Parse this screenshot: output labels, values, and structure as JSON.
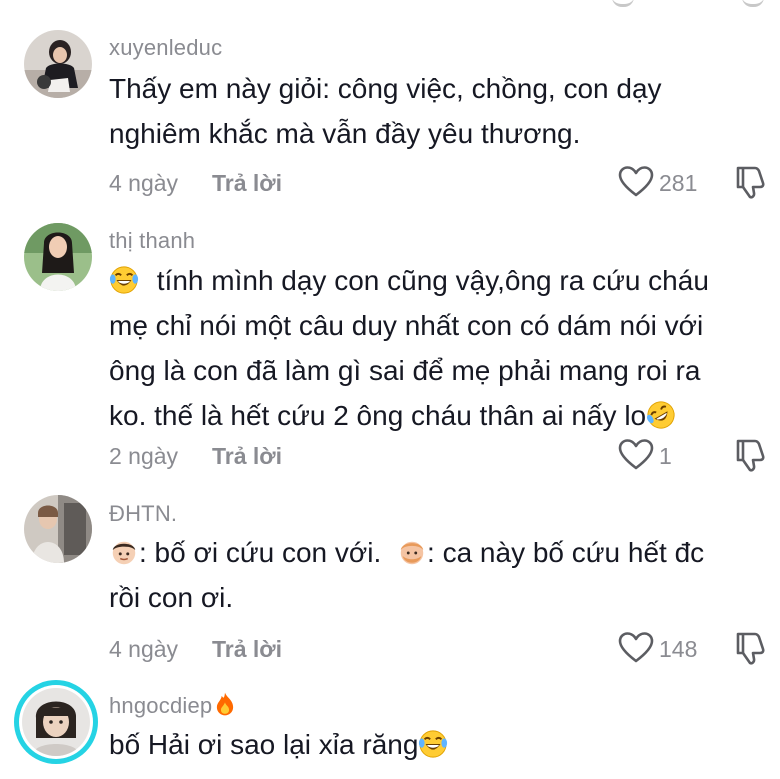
{
  "comments": [
    {
      "username": "xuyenleduc",
      "lines": [
        "Thấy em này giỏi: công việc, chồng, con dạy",
        "nghiêm khắc mà vẫn đầy yêu thương."
      ],
      "time": "4 ngày",
      "reply_label": "Trả lời",
      "likes": "281"
    },
    {
      "username": "thị thanh",
      "lines": [
        "tính mình dạy con cũng vậy,ông ra cứu cháu",
        "mẹ chỉ nói một câu duy nhất con có dám nói với",
        "ông là con đã làm gì sai để mẹ phải mang roi ra",
        "ko. thế là hết cứu 2 ông cháu thân ai nấy lo"
      ],
      "time": "2 ngày",
      "reply_label": "Trả lời",
      "likes": "1"
    },
    {
      "username": "ĐHTN.",
      "lines": [
        ": bố ơi cứu con với.",
        ": ca này bố cứu hết đc",
        "rồi con ơi."
      ],
      "time": "4 ngày",
      "reply_label": "Trả lời",
      "likes": "148"
    },
    {
      "username": "hngocdiep",
      "lines": [
        "bố Hải ơi sao lại xỉa răng"
      ]
    }
  ],
  "icons": {
    "like": "heart-outline-icon",
    "dislike": "thumbs-down-outline-icon",
    "emoji_laugh": "face-with-tears-of-joy",
    "emoji_rofl": "rolling-on-the-floor-laughing",
    "emoji_boy": "boy-face",
    "emoji_man": "man-face",
    "emoji_fire": "fire"
  },
  "colors": {
    "text": "#161823",
    "muted": "#8a8b91",
    "story_ring": "#25d3e4"
  }
}
